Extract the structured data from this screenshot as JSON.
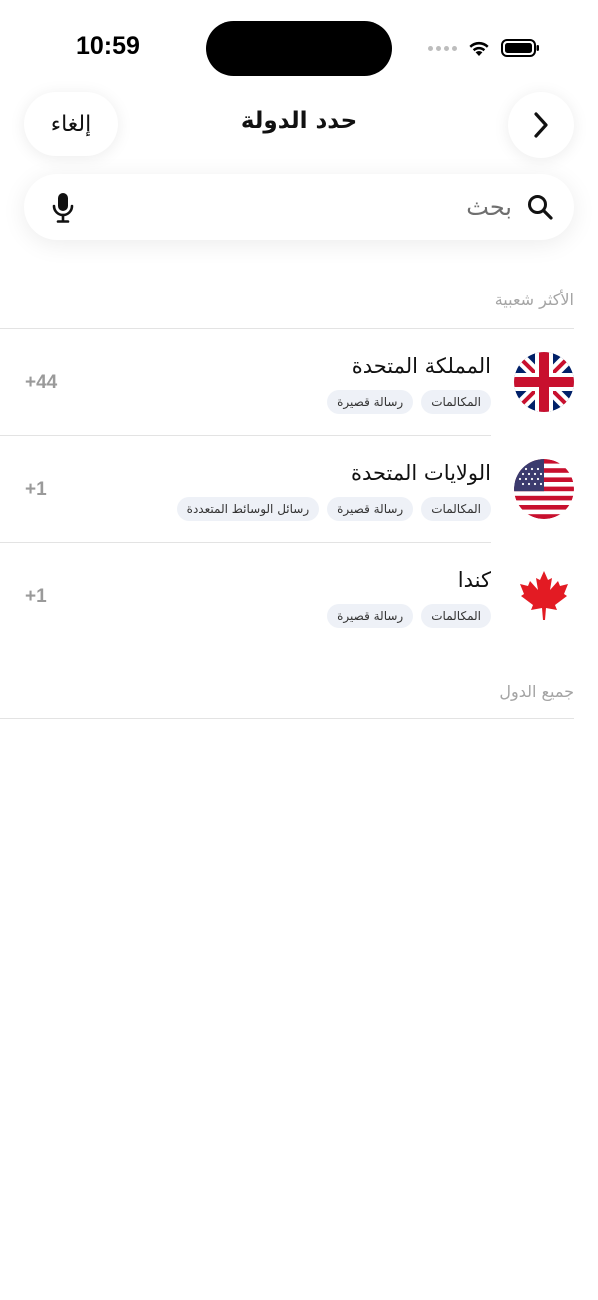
{
  "status_bar": {
    "time": "10:59"
  },
  "header": {
    "title": "حدد الدولة",
    "cancel_label": "إلغاء"
  },
  "search": {
    "placeholder": "بحث",
    "value": ""
  },
  "sections": {
    "popular_title": "الأكثر شعبية",
    "all_title": "جميع الدول"
  },
  "countries": [
    {
      "name": "المملكة المتحدة",
      "code": "+44",
      "flag_icon": "uk-flag-icon",
      "tags": [
        "المكالمات",
        "رسالة قصيرة"
      ]
    },
    {
      "name": "الولايات المتحدة",
      "code": "+1",
      "flag_icon": "us-flag-icon",
      "tags": [
        "المكالمات",
        "رسالة قصيرة",
        "رسائل الوسائط المتعددة"
      ]
    },
    {
      "name": "كندا",
      "code": "+1",
      "flag_icon": "canada-flag-icon",
      "tags": [
        "المكالمات",
        "رسالة قصيرة"
      ]
    }
  ],
  "colors": {
    "tag_bg": "#eef1f7",
    "muted_text": "#a4a4a4",
    "dial_code": "#9a9a9a",
    "uk_blue": "#012169",
    "flag_red": "#c8102e",
    "us_blue": "#3c3b6e",
    "canada_red": "#e31b23"
  }
}
